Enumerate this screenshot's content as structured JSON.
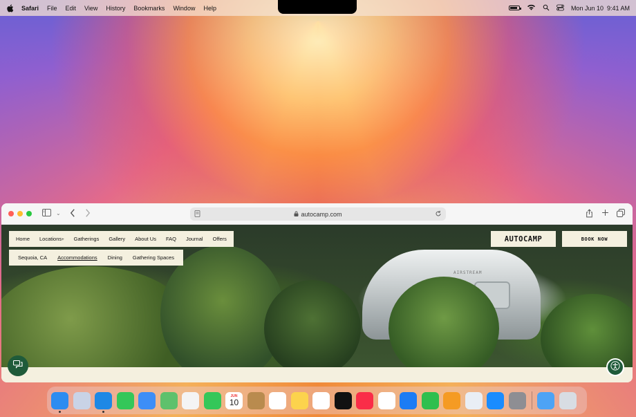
{
  "menubar": {
    "app": "Safari",
    "items": [
      "File",
      "Edit",
      "View",
      "History",
      "Bookmarks",
      "Window",
      "Help"
    ],
    "datetime": "Mon Jun 10  9:41 AM",
    "battery_level": 0.85
  },
  "safari": {
    "url": "autocamp.com"
  },
  "site": {
    "nav": [
      "Home",
      "Locations",
      "Gatherings",
      "Gallery",
      "About Us",
      "FAQ",
      "Journal",
      "Offers"
    ],
    "locations_caret": "+",
    "subnav": [
      "Sequoia, CA",
      "Accommodations",
      "Dining",
      "Gathering Spaces"
    ],
    "subnav_active": "Accommodations",
    "logo": "AUTOCAMP",
    "book_label": "BOOK NOW",
    "trailer_text": "AIRSTREAM"
  },
  "dock": {
    "calendar_month": "JUN",
    "calendar_day": "10",
    "apps": [
      {
        "name": "finder",
        "color": "#2d8cf0"
      },
      {
        "name": "launchpad",
        "color": "#c9d3e6"
      },
      {
        "name": "safari",
        "color": "#1e88e5"
      },
      {
        "name": "messages",
        "color": "#34c759"
      },
      {
        "name": "mail",
        "color": "#3d8ef7"
      },
      {
        "name": "maps",
        "color": "#5ec16c"
      },
      {
        "name": "photos",
        "color": "#f4f4f4"
      },
      {
        "name": "facetime",
        "color": "#34c759"
      },
      {
        "name": "calendar",
        "color": "#ffffff"
      },
      {
        "name": "contacts",
        "color": "#b98b4e"
      },
      {
        "name": "reminders",
        "color": "#ffffff"
      },
      {
        "name": "notes",
        "color": "#fcd34d"
      },
      {
        "name": "freeform",
        "color": "#ffffff"
      },
      {
        "name": "tv",
        "color": "#111111"
      },
      {
        "name": "music",
        "color": "#fa2d48"
      },
      {
        "name": "news",
        "color": "#ffffff"
      },
      {
        "name": "keynote",
        "color": "#1c7cf4"
      },
      {
        "name": "numbers",
        "color": "#2fbf4e"
      },
      {
        "name": "pages",
        "color": "#f59b23"
      },
      {
        "name": "iphone-mirroring",
        "color": "#e9eef5"
      },
      {
        "name": "app-store",
        "color": "#1a8cff"
      },
      {
        "name": "system-settings",
        "color": "#8e8e93"
      },
      {
        "name": "downloads-folder",
        "color": "#4da3f5"
      },
      {
        "name": "trash",
        "color": "#d8dde3"
      }
    ]
  }
}
